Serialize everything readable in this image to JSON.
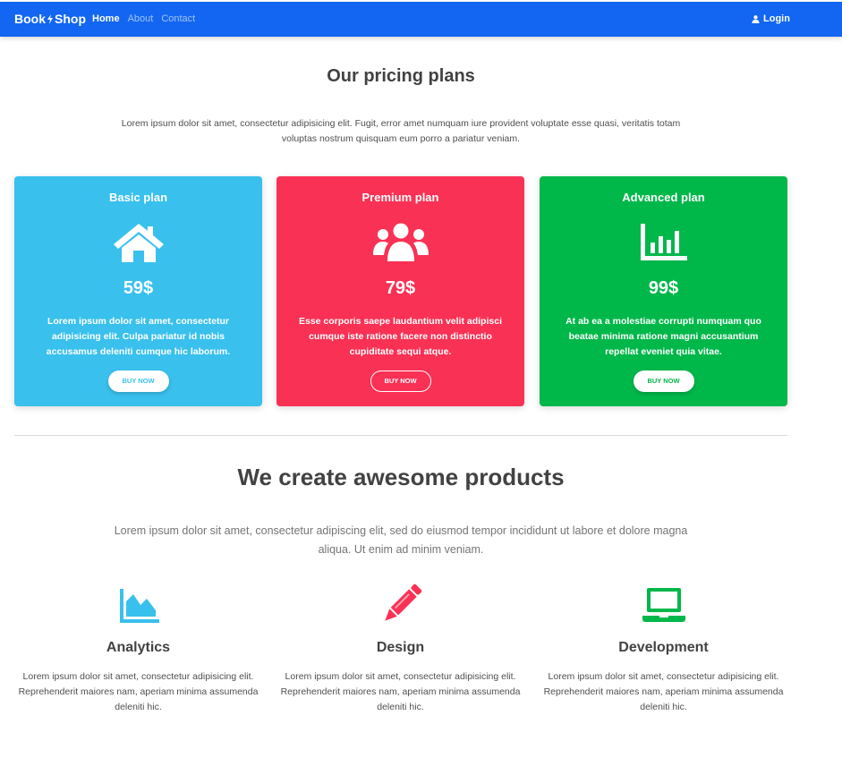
{
  "navbar": {
    "brand_left": "Book",
    "brand_right": "Shop",
    "links": [
      "Home",
      "About",
      "Contact"
    ],
    "login": "Login",
    "color": "#1266f1"
  },
  "pricing": {
    "title": "Our pricing plans",
    "lead": "Lorem ipsum dolor sit amet, consectetur adipisicing elit. Fugit, error amet numquam iure provident voluptate esse quasi, veritatis totam voluptas nostrum quisquam eum porro a pariatur veniam.",
    "plans": [
      {
        "name": "Basic plan",
        "icon": "home-icon",
        "price": "59$",
        "text": "Lorem ipsum dolor sit amet, consectetur adipisicing elit. Culpa pariatur id nobis accusamus deleniti cumque hic laborum.",
        "button": "Buy now",
        "color": "#39c0ed"
      },
      {
        "name": "Premium plan",
        "icon": "users-icon",
        "price": "79$",
        "text": "Esse corporis saepe laudantium velit adipisci cumque iste ratione facere non distinctio cupiditate sequi atque.",
        "button": "Buy now",
        "color": "#f93154"
      },
      {
        "name": "Advanced plan",
        "icon": "chart-bar-icon",
        "price": "99$",
        "text": "At ab ea a molestiae corrupti numquam quo beatae minima ratione magni accusantium repellat eveniet quia vitae.",
        "button": "Buy now",
        "color": "#00b74a"
      }
    ]
  },
  "products": {
    "title": "We create awesome products",
    "lead": "Lorem ipsum dolor sit amet, consectetur adipiscing elit, sed do eiusmod tempor incididunt ut labore et dolore magna aliqua. Ut enim ad minim veniam.",
    "features": [
      {
        "title": "Analytics",
        "icon": "chart-area-icon",
        "text": "Lorem ipsum dolor sit amet, consectetur adipisicing elit. Reprehenderit maiores nam, aperiam minima assumenda deleniti hic.",
        "color": "#39c0ed"
      },
      {
        "title": "Design",
        "icon": "pencil-icon",
        "text": "Lorem ipsum dolor sit amet, consectetur adipisicing elit. Reprehenderit maiores nam, aperiam minima assumenda deleniti hic.",
        "color": "#f93154"
      },
      {
        "title": "Development",
        "icon": "laptop-icon",
        "text": "Lorem ipsum dolor sit amet, consectetur adipisicing elit. Reprehenderit maiores nam, aperiam minima assumenda deleniti hic.",
        "color": "#00b74a"
      }
    ]
  }
}
